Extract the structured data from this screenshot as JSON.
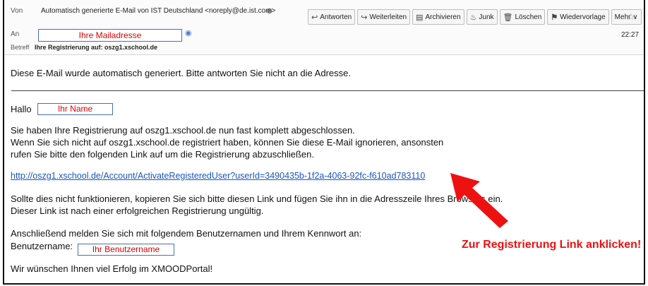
{
  "header": {
    "from_label": "Von",
    "from_value": "Automatisch generierte E-Mail von IST Deutschland <noreply@de.ist.com>",
    "to_label": "An",
    "to_placeholder": "Ihre Mailadresse",
    "subject_label": "Betreff",
    "subject_value": "Ihre Registrierung auf: oszg1.xschool.de",
    "time": "22:27"
  },
  "toolbar": {
    "reply": "Antworten",
    "forward": "Weiterleiten",
    "archive": "Archivieren",
    "junk": "Junk",
    "delete": "Löschen",
    "tag": "Wiedervorlage",
    "more": "Mehr ∨"
  },
  "body": {
    "notice": "Diese E-Mail wurde automatisch generiert. Bitte antworten Sie nicht an die Adresse.",
    "greeting": "Hallo",
    "name_placeholder": "Ihr Name",
    "line1": "Sie haben Ihre Registrierung auf oszg1.xschool.de nun fast komplett abgeschlossen.",
    "line2": "Wenn Sie sich nicht auf oszg1.xschool.de registriert haben, können Sie diese E-Mail ignorieren, ansonsten",
    "line3": "rufen Sie bitte den folgenden Link auf um die Registrierung abzuschließen.",
    "link": "http://oszg1.xschool.de/Account/ActivateRegisteredUser?userId=3490435b-1f2a-4063-92fc-f610ad783110",
    "line4": "Sollte dies nicht funktionieren, kopieren Sie sich bitte diesen Link und fügen Sie ihn in die Adresszeile Ihres Browsers ein.",
    "line5": "Dieser Link ist nach einer erfolgreichen Registrierung ungültig.",
    "line6": "Anschließend melden Sie sich mit folgendem Benutzernamen und Ihrem Kennwort an:",
    "username_label": "Benutzername:",
    "username_placeholder": "Ihr Benutzername",
    "closing": "Wir wünschen Ihnen viel Erfolg im XMOODPortal!"
  },
  "annotation": {
    "text": "Zur Registrierung Link anklicken!",
    "color": "#ee1111"
  }
}
